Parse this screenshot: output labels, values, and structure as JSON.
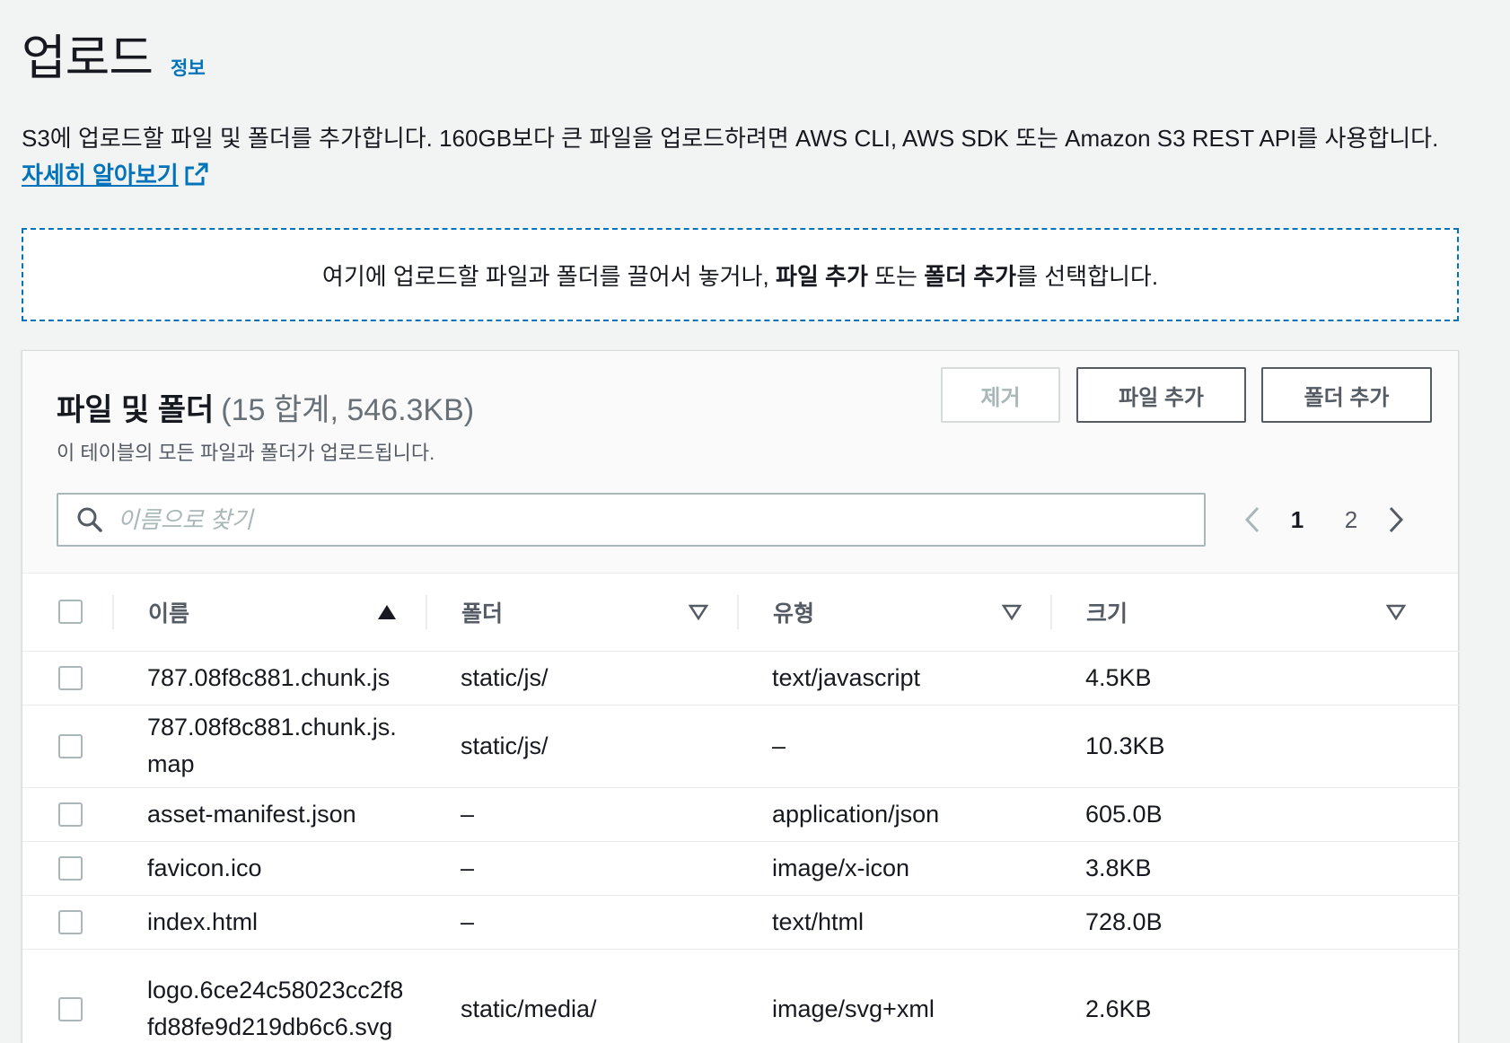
{
  "header": {
    "title": "업로드",
    "info_label": "정보"
  },
  "description": {
    "text": "S3에 업로드할 파일 및 폴더를 추가합니다. 160GB보다 큰 파일을 업로드하려면 AWS CLI, AWS SDK 또는 Amazon S3 REST API를 사용합니다.",
    "learn_more": "자세히 알아보기"
  },
  "dropzone": {
    "prefix": "여기에 업로드할 파일과 폴더를 끌어서 놓거나,",
    "add_files": "파일 추가",
    "or": "또는",
    "add_folder": "폴더 추가",
    "suffix": "를 선택합니다."
  },
  "panel": {
    "title": "파일 및 폴더",
    "count": "(15 합계, 546.3KB)",
    "description": "이 테이블의 모든 파일과 폴더가 업로드됩니다.",
    "buttons": {
      "remove": "제거",
      "add_files": "파일 추가",
      "add_folder": "폴더 추가"
    },
    "search": {
      "placeholder": "이름으로 찾기",
      "value": ""
    },
    "pagination": {
      "pages": [
        "1",
        "2"
      ],
      "current": "1"
    }
  },
  "table": {
    "columns": [
      "이름",
      "폴더",
      "유형",
      "크기"
    ],
    "sort": {
      "column": "이름",
      "direction": "ascending"
    },
    "rows": [
      {
        "name": "787.08f8c881.chunk.js",
        "folder": "static/js/",
        "type": "text/javascript",
        "size": "4.5KB"
      },
      {
        "name": "787.08f8c881.chunk.js.map",
        "folder": "static/js/",
        "type": "–",
        "size": "10.3KB"
      },
      {
        "name": "asset-manifest.json",
        "folder": "–",
        "type": "application/json",
        "size": "605.0B"
      },
      {
        "name": "favicon.ico",
        "folder": "–",
        "type": "image/x-icon",
        "size": "3.8KB"
      },
      {
        "name": "index.html",
        "folder": "–",
        "type": "text/html",
        "size": "728.0B"
      },
      {
        "name": "logo.6ce24c58023cc2f8fd88fe9d219db6c6.svg",
        "folder": "static/media/",
        "type": "image/svg+xml",
        "size": "2.6KB"
      }
    ]
  },
  "colors": {
    "link": "#0073bb",
    "text": "#16191f",
    "muted": "#545b64",
    "border": "#aab7b8",
    "background": "#f2f3f3"
  },
  "icons": [
    "external-link-icon",
    "search-icon",
    "chevron-left-icon",
    "chevron-right-icon",
    "sort-ascending-icon",
    "sort-caret-icon"
  ]
}
